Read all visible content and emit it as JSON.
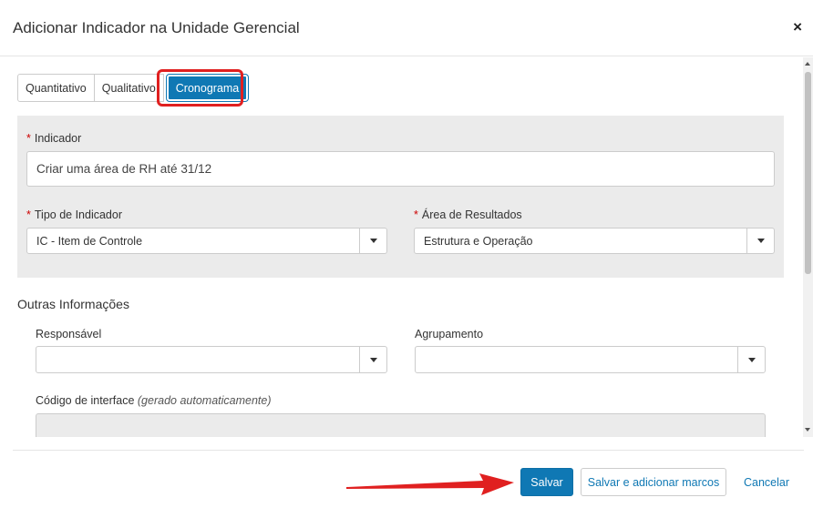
{
  "modal": {
    "title": "Adicionar Indicador na Unidade Gerencial",
    "close_label": "×"
  },
  "tabs": [
    {
      "label": "Quantitativo",
      "active": false
    },
    {
      "label": "Qualitativo",
      "active": false
    },
    {
      "label": "Cronograma",
      "active": true
    }
  ],
  "form": {
    "required_mark": "*",
    "indicador": {
      "label": "Indicador",
      "value": "Criar uma área de RH até 31/12"
    },
    "tipo_indicador": {
      "label": "Tipo de Indicador",
      "value": "IC - Item de Controle"
    },
    "area_resultados": {
      "label": "Área de Resultados",
      "value": "Estrutura e Operação"
    }
  },
  "outras": {
    "title": "Outras Informações",
    "responsavel": {
      "label": "Responsável",
      "value": ""
    },
    "agrupamento": {
      "label": "Agrupamento",
      "value": ""
    },
    "codigo": {
      "label": "Código de interface",
      "note": "(gerado automaticamente)",
      "value": ""
    }
  },
  "footer": {
    "save_label": "Salvar",
    "save_add_label": "Salvar e adicionar marcos",
    "cancel_label": "Cancelar"
  },
  "colors": {
    "primary": "#0f78b4",
    "highlight": "#e02020",
    "required": "#cc0000"
  }
}
